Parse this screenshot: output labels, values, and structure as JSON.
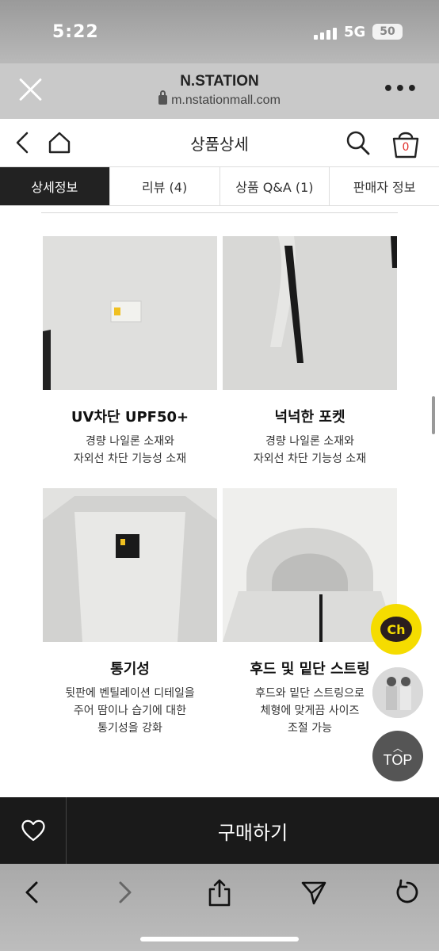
{
  "status": {
    "time": "5:22",
    "network": "5G",
    "battery": "50"
  },
  "browser": {
    "site_title": "N.STATION",
    "url": "m.nstationmall.com"
  },
  "header": {
    "title": "상품상세",
    "cart_count": "0"
  },
  "tabs": [
    {
      "label": "상세정보"
    },
    {
      "label": "리뷰 (4)"
    },
    {
      "label": "상품 Q&A (1)"
    },
    {
      "label": "판매자 정보"
    }
  ],
  "features": [
    {
      "title": "UV차단 UPF50+",
      "desc": "경량 나일론 소재와\n자외선 차단 기능성 소재"
    },
    {
      "title": "넉넉한 포켓",
      "desc": "경량 나일론 소재와\n자외선 차단 기능성 소재"
    },
    {
      "title": "통기성",
      "desc": "뒷판에 벤틸레이션 디테일을\n주어 땀이나 습기에 대한\n통기성을 강화"
    },
    {
      "title": "후드 및 밑단 스트링",
      "desc": "후드와 밑단 스트링으로\n체형에 맞게끔 사이즈\n조절 가능"
    }
  ],
  "kakao_label": "Ch",
  "top_label": "TOP",
  "buy_label": "구매하기",
  "colors": {
    "active_tab": "#222222",
    "kakao": "#f5dc00",
    "buy_bar": "#1a1a1a"
  }
}
